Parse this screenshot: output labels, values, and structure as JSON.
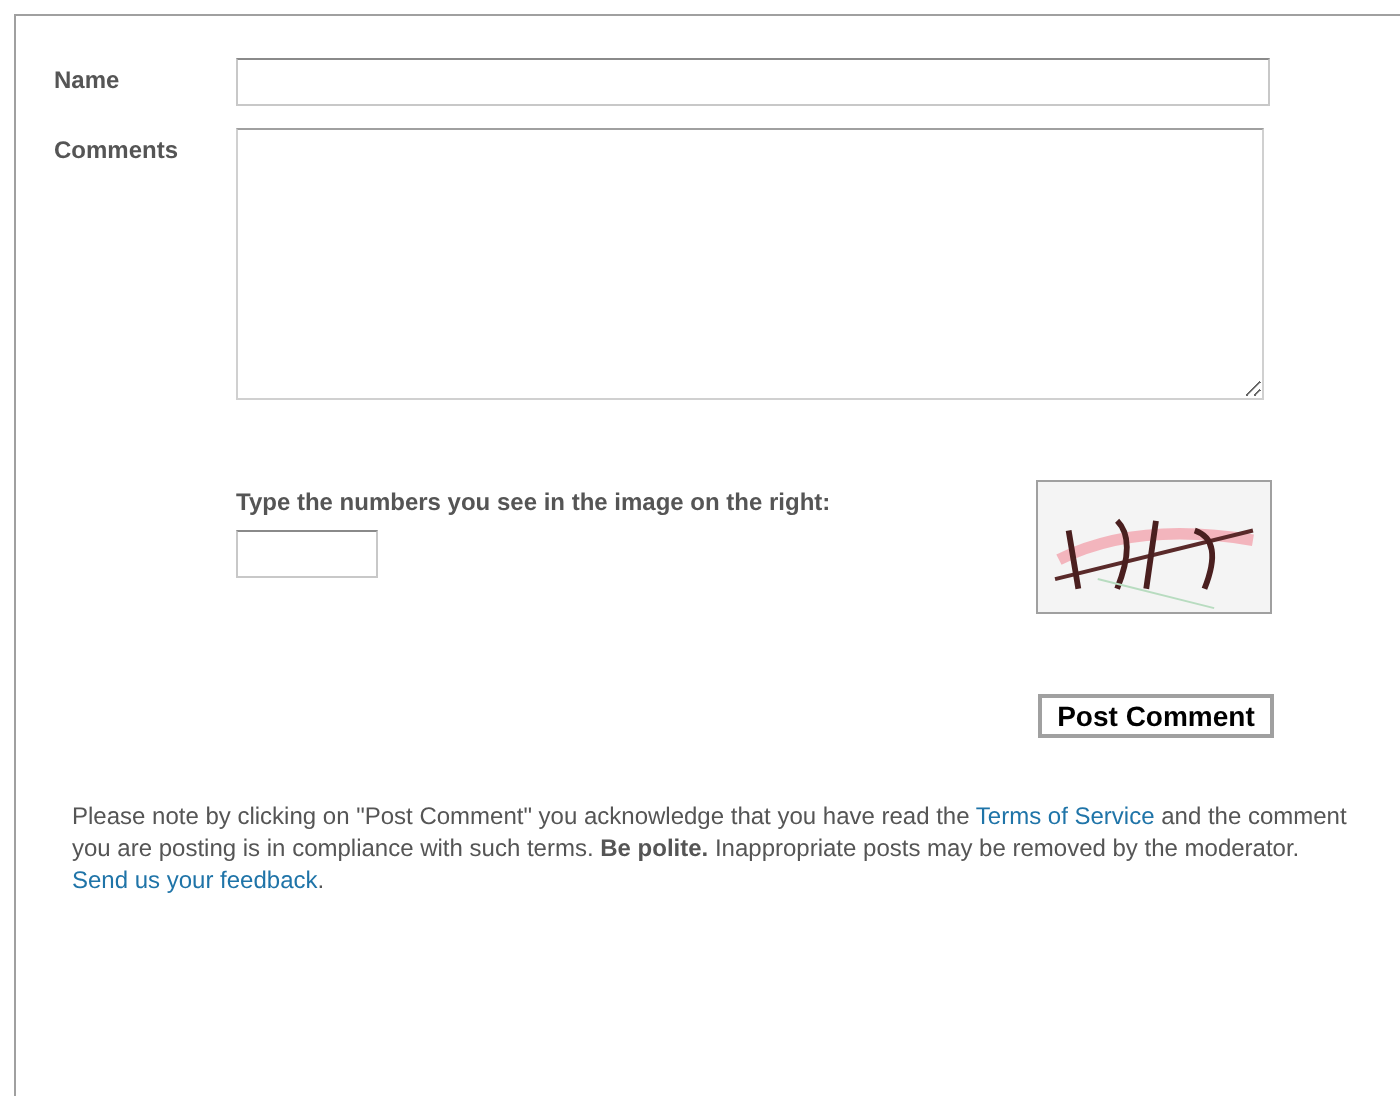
{
  "form": {
    "name_label": "Name",
    "comments_label": "Comments",
    "captcha_prompt": "Type the numbers you see in the image on the right:",
    "submit_button": "Post Comment"
  },
  "notice": {
    "text_before": "Please note by clicking on \"Post Comment\" you acknowledge that you have read the ",
    "terms_link": "Terms of Service",
    "text_middle": " and the comment you are posting is in compliance with such terms. **Be polite.** Inappropriate posts may be removed by the moderator. ",
    "feedback_link": "Send us your feedback",
    "text_after": "."
  }
}
